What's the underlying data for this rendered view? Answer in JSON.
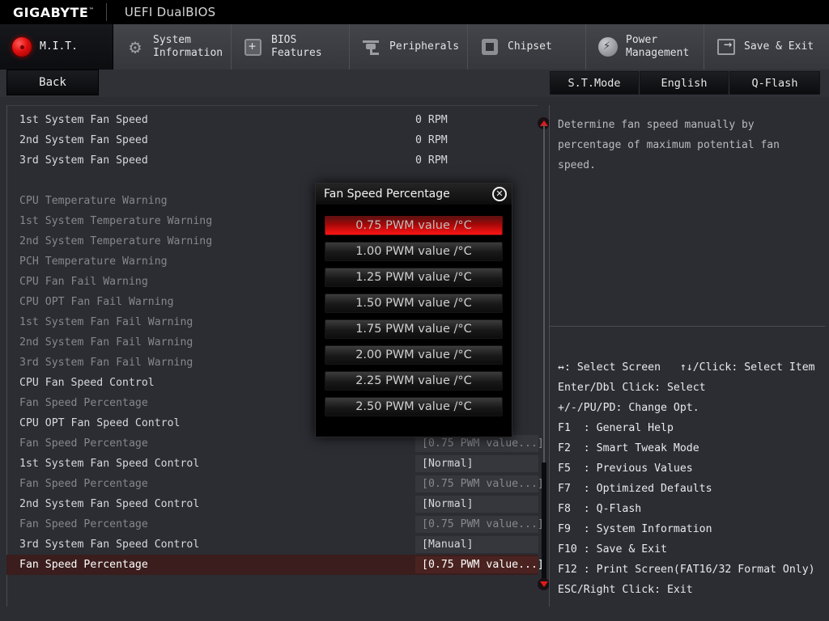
{
  "titlebar": {
    "brand": "GIGABYTE",
    "trademark": "™",
    "suite": "UEFI DualBIOS"
  },
  "nav": {
    "tabs": [
      {
        "label": "M.I.T.",
        "icon": "red-dot-icon",
        "active": true
      },
      {
        "label": "System\nInformation",
        "icon": "gear-icon",
        "active": false
      },
      {
        "label": "BIOS\nFeatures",
        "icon": "chip-plus-icon",
        "active": false
      },
      {
        "label": "Peripherals",
        "icon": "peripherals-icon",
        "active": false
      },
      {
        "label": "Chipset",
        "icon": "chipset-icon",
        "active": false
      },
      {
        "label": "Power\nManagement",
        "icon": "power-bolt-icon",
        "active": false
      },
      {
        "label": "Save & Exit",
        "icon": "exit-arrow-icon",
        "active": false
      }
    ]
  },
  "subbar": {
    "back": "Back",
    "stmode": "S.T.Mode",
    "language": "English",
    "qflash": "Q-Flash"
  },
  "settings": {
    "rows": [
      {
        "label": "1st System Fan Speed",
        "value": "0 RPM",
        "dim": false,
        "valbg": false,
        "selected": false
      },
      {
        "label": "2nd System Fan Speed",
        "value": "0 RPM",
        "dim": false,
        "valbg": false,
        "selected": false
      },
      {
        "label": "3rd System Fan Speed",
        "value": "0 RPM",
        "dim": false,
        "valbg": false,
        "selected": false
      },
      {
        "label": "",
        "value": "",
        "dim": false,
        "valbg": false,
        "selected": false
      },
      {
        "label": "CPU Temperature Warning",
        "value": "",
        "dim": true,
        "valbg": false,
        "selected": false
      },
      {
        "label": "1st System Temperature Warning",
        "value": "",
        "dim": true,
        "valbg": false,
        "selected": false
      },
      {
        "label": "2nd System Temperature Warning",
        "value": "",
        "dim": true,
        "valbg": false,
        "selected": false
      },
      {
        "label": "PCH Temperature Warning",
        "value": "",
        "dim": true,
        "valbg": false,
        "selected": false
      },
      {
        "label": "CPU Fan Fail Warning",
        "value": "",
        "dim": true,
        "valbg": false,
        "selected": false
      },
      {
        "label": "CPU OPT Fan Fail Warning",
        "value": "",
        "dim": true,
        "valbg": false,
        "selected": false
      },
      {
        "label": "1st System Fan Fail Warning",
        "value": "",
        "dim": true,
        "valbg": false,
        "selected": false
      },
      {
        "label": "2nd System Fan Fail Warning",
        "value": "",
        "dim": true,
        "valbg": false,
        "selected": false
      },
      {
        "label": "3rd System Fan Fail Warning",
        "value": "",
        "dim": true,
        "valbg": false,
        "selected": false
      },
      {
        "label": "CPU Fan Speed Control",
        "value": "",
        "dim": false,
        "valbg": false,
        "selected": false
      },
      {
        "label": "Fan Speed Percentage",
        "value": "...]",
        "dim": true,
        "valbg": false,
        "selected": false
      },
      {
        "label": "CPU OPT Fan Speed Control",
        "value": "",
        "dim": false,
        "valbg": false,
        "selected": false
      },
      {
        "label": "Fan Speed Percentage",
        "value": "[0.75 PWM value...]",
        "dim": true,
        "valbg": true,
        "selected": false
      },
      {
        "label": "1st System Fan Speed Control",
        "value": "[Normal]",
        "dim": false,
        "valbg": true,
        "selected": false
      },
      {
        "label": "Fan Speed Percentage",
        "value": "[0.75 PWM value...]",
        "dim": true,
        "valbg": true,
        "selected": false
      },
      {
        "label": "2nd System Fan Speed Control",
        "value": "[Normal]",
        "dim": false,
        "valbg": true,
        "selected": false
      },
      {
        "label": "Fan Speed Percentage",
        "value": "[0.75 PWM value...]",
        "dim": true,
        "valbg": true,
        "selected": false
      },
      {
        "label": "3rd System Fan Speed Control",
        "value": "[Manual]",
        "dim": false,
        "valbg": true,
        "selected": false
      },
      {
        "label": "Fan Speed Percentage",
        "value": "[0.75 PWM value...]",
        "dim": false,
        "valbg": true,
        "selected": true
      }
    ]
  },
  "dialog": {
    "title": "Fan Speed Percentage",
    "close_icon": "✕",
    "options": [
      {
        "label": "0.75 PWM value /°C",
        "selected": true
      },
      {
        "label": "1.00 PWM value /°C",
        "selected": false
      },
      {
        "label": "1.25 PWM value /°C",
        "selected": false
      },
      {
        "label": "1.50 PWM value /°C",
        "selected": false
      },
      {
        "label": "1.75 PWM value /°C",
        "selected": false
      },
      {
        "label": "2.00 PWM value /°C",
        "selected": false
      },
      {
        "label": "2.25 PWM value /°C",
        "selected": false
      },
      {
        "label": "2.50 PWM value /°C",
        "selected": false
      }
    ]
  },
  "help": {
    "description": "Determine fan speed manually by percentage of maximum potential fan speed.",
    "keys": [
      "↔: Select Screen   ↑↓/Click: Select Item",
      "Enter/Dbl Click: Select",
      "+/-/PU/PD: Change Opt.",
      "F1  : General Help",
      "F2  : Smart Tweak Mode",
      "F5  : Previous Values",
      "F7  : Optimized Defaults",
      "F8  : Q-Flash",
      "F9  : System Information",
      "F10 : Save & Exit",
      "F12 : Print Screen(FAT16/32 Format Only)",
      "ESC/Right Click: Exit"
    ]
  },
  "scrollbar": {
    "up_icon": "triangle-up-icon",
    "down_icon": "triangle-down-icon"
  },
  "colors": {
    "accent_red": "#e01a1a",
    "panel_bg": "#2b2d33",
    "selected_row": "#3a1d1c"
  }
}
